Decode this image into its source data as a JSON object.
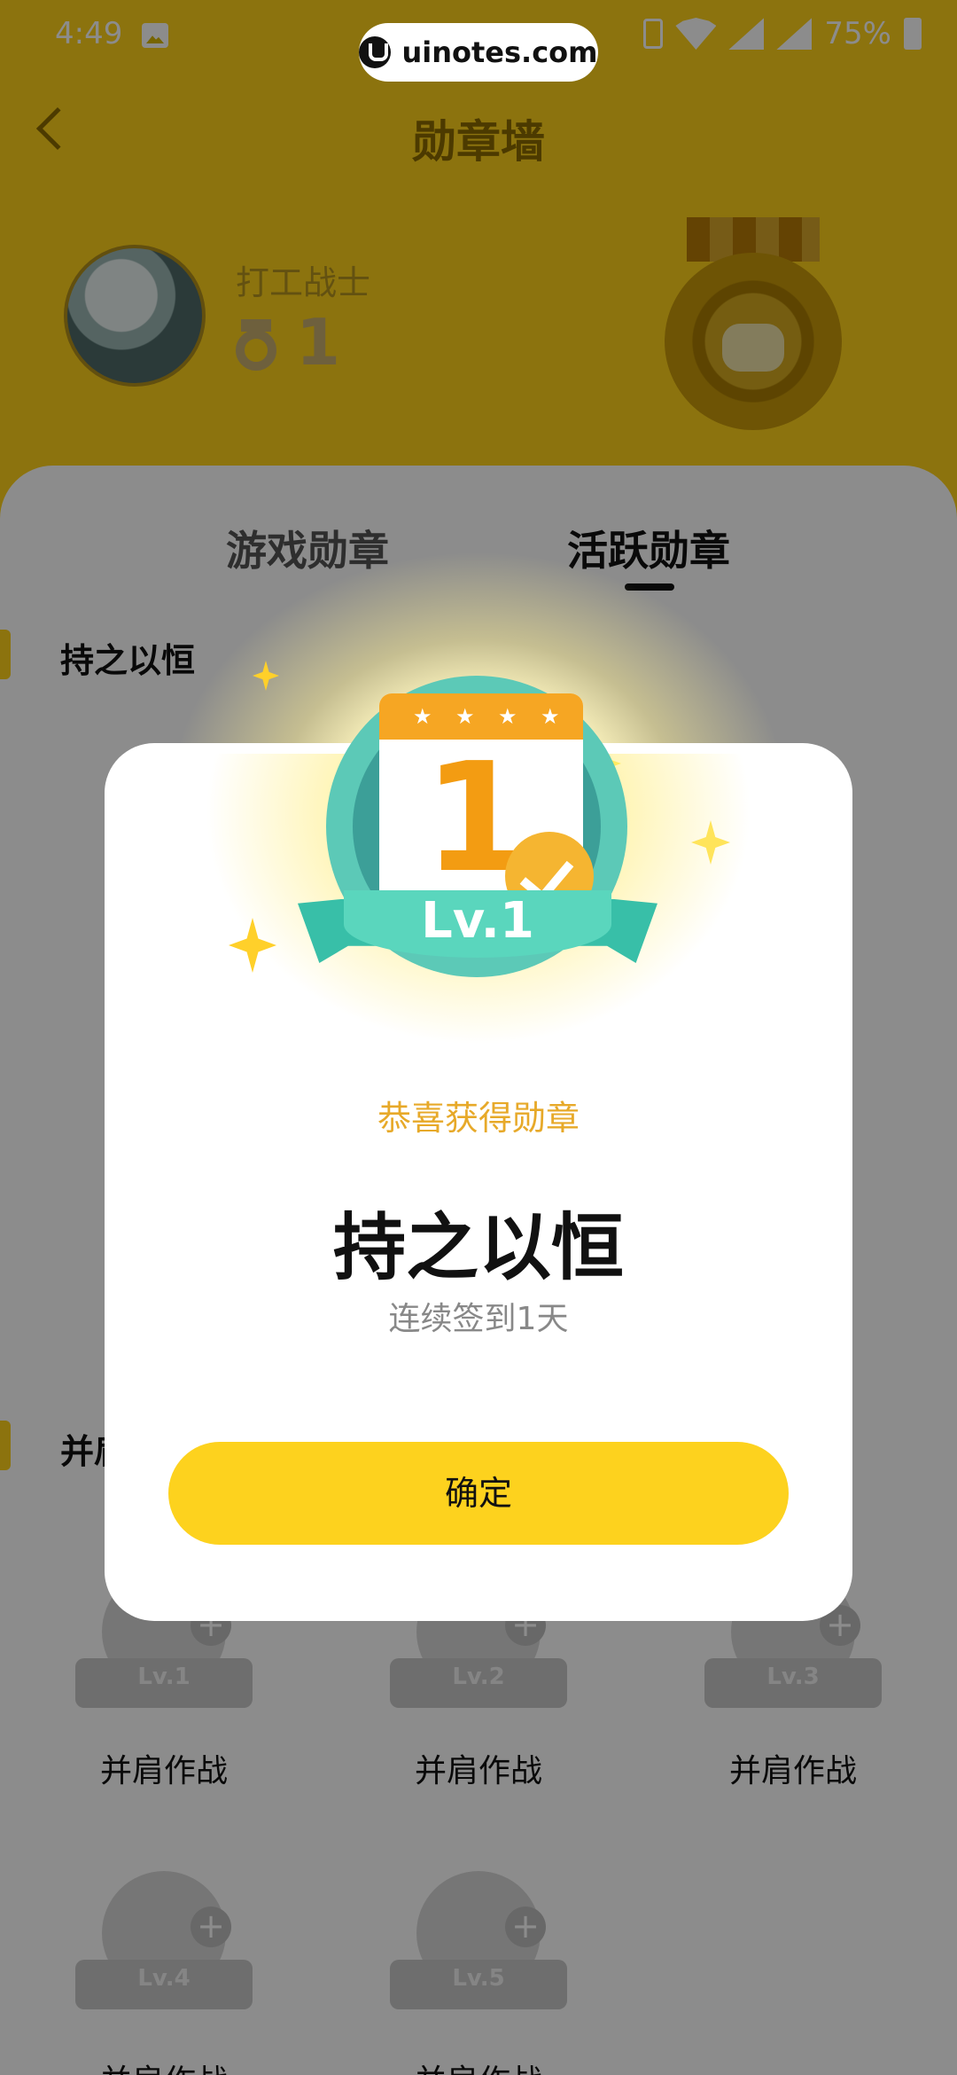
{
  "status_bar": {
    "time": "4:49",
    "battery": "75%",
    "watermark": "uinotes.com"
  },
  "header": {
    "title": "勋章墙",
    "username": "打工战士",
    "medal_count": "1"
  },
  "tabs": [
    {
      "label": "游戏勋章",
      "active": false
    },
    {
      "label": "活跃勋章",
      "active": true
    }
  ],
  "sections": [
    {
      "title": "持之以恒"
    },
    {
      "title": "并肩作战",
      "items": [
        {
          "level": "Lv.1",
          "label": "并肩作战"
        },
        {
          "level": "Lv.2",
          "label": "并肩作战"
        },
        {
          "level": "Lv.3",
          "label": "并肩作战"
        },
        {
          "level": "Lv.4",
          "label": "并肩作战"
        },
        {
          "level": "Lv.5",
          "label": "并肩作战"
        }
      ]
    }
  ],
  "modal": {
    "award_level": "Lv.1",
    "calendar_number": "1",
    "congrats": "恭喜获得勋章",
    "badge_name": "持之以恒",
    "badge_desc": "连续签到1天",
    "confirm_label": "确定"
  },
  "colors": {
    "brand_yellow": "#ffd21a",
    "award_teal": "#38bfa8",
    "award_orange": "#f39c12",
    "congrats_text": "#e7a929"
  }
}
